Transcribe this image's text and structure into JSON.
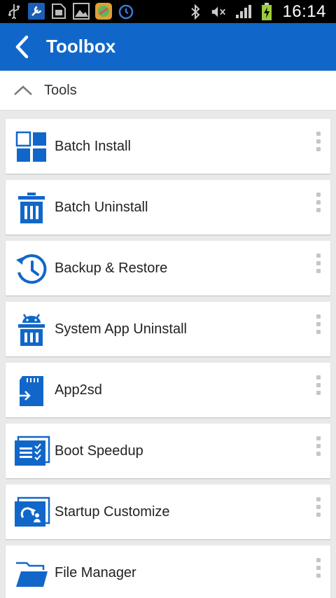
{
  "status_bar": {
    "time": "16:14"
  },
  "app_bar": {
    "title": "Toolbox"
  },
  "section": {
    "label": "Tools"
  },
  "tools": [
    {
      "label": "Batch Install",
      "icon": "grid-icon"
    },
    {
      "label": "Batch Uninstall",
      "icon": "trash-icon"
    },
    {
      "label": "Backup & Restore",
      "icon": "clock-restore-icon"
    },
    {
      "label": "System App Uninstall",
      "icon": "android-trash-icon"
    },
    {
      "label": "App2sd",
      "icon": "sdcard-icon"
    },
    {
      "label": "Boot Speedup",
      "icon": "boot-list-icon"
    },
    {
      "label": "Startup Customize",
      "icon": "startup-icon"
    },
    {
      "label": "File Manager",
      "icon": "folder-icon"
    }
  ],
  "colors": {
    "accent": "#1167c9",
    "background": "#e9e9e9"
  }
}
